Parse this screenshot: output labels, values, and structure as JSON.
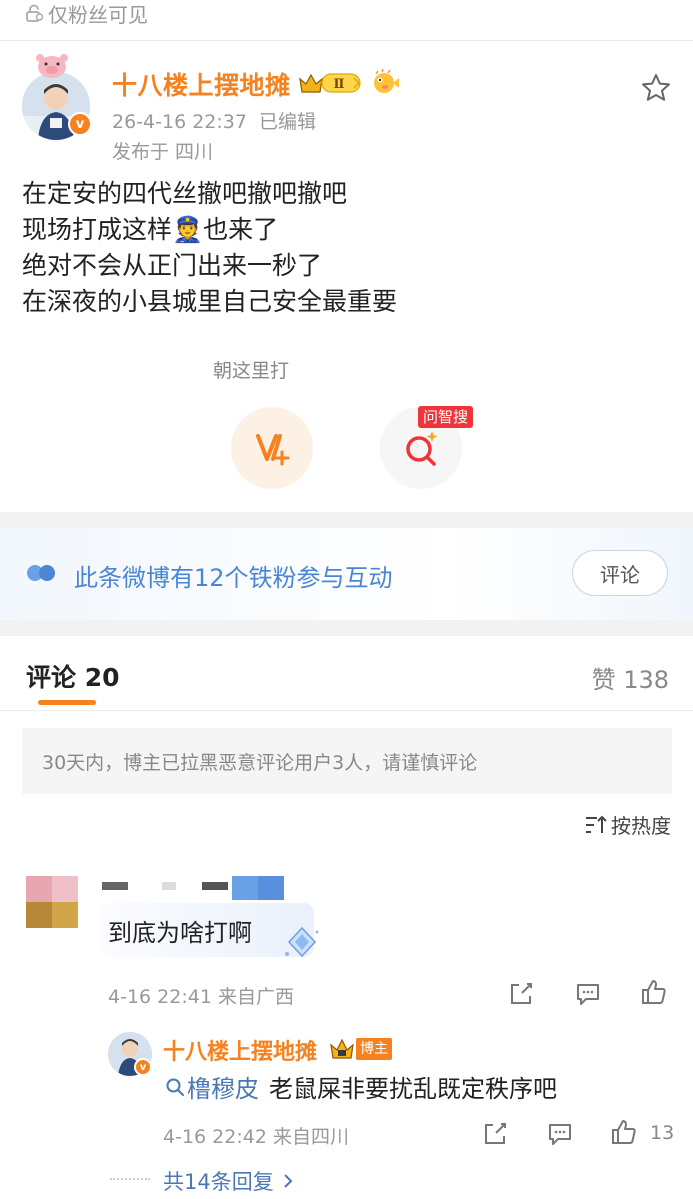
{
  "visibility": {
    "label": "仅粉丝可见",
    "icon": "lock-person-icon"
  },
  "post": {
    "author": "十八楼上摆地摊",
    "level_badge": "Ⅱ",
    "verified_badge": "v",
    "time": "26-4-16 22:37",
    "edited": "已编辑",
    "location": "发布于 四川",
    "lines": [
      "在定安的四代丝撤吧撤吧撤吧",
      "现场打成这样",
      "也来了",
      "绝对不会从正门出来一秒了",
      "在深夜的小县城里自己安全最重要"
    ],
    "police_emoji": "👮"
  },
  "actions": {
    "hint": "朝这里打",
    "search_tag": "问智搜"
  },
  "fans_banner": {
    "text": "此条微博有12个铁粉参与互动",
    "button": "评论"
  },
  "comments_header": {
    "tab_label": "评论 20",
    "likes_label": "赞 138"
  },
  "notice": "30天内，博主已拉黑恶意评论用户3人，请谨慎评论",
  "sort_label": "按热度",
  "comment": {
    "text": "到底为啥打啊",
    "meta": "4-16 22:41  来自广西"
  },
  "reply": {
    "author": "十八楼上摆地摊",
    "tag": "博主",
    "mention": "橹穆皮",
    "text": "老鼠屎非要扰乱既定秩序吧",
    "meta": "4-16 22:42  来自四川",
    "likes": "13"
  },
  "more_replies": "共14条回复",
  "colors": {
    "accent": "#f5821f",
    "link": "#4a78b7",
    "banner_text": "#4a86d4",
    "tag_red": "#f0353a"
  }
}
